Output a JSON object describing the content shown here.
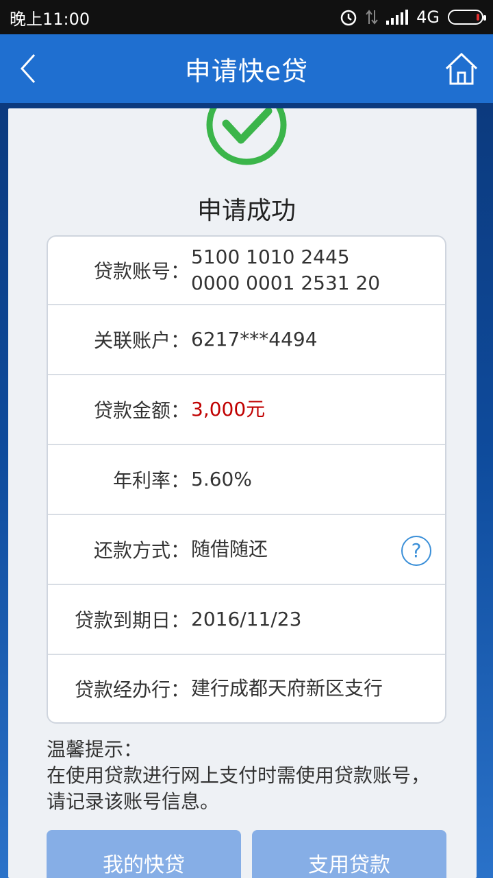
{
  "status_bar": {
    "time": "晚上11:00",
    "network": "4G"
  },
  "nav": {
    "title": "申请快e贷"
  },
  "result": {
    "title": "申请成功"
  },
  "details": [
    {
      "label": "贷款账号：",
      "value": "5100 1010 2445 0000 0001 2531 20"
    },
    {
      "label": "关联账户：",
      "value": "6217***4494"
    },
    {
      "label": "贷款金额：",
      "value": "3,000元"
    },
    {
      "label": "年利率：",
      "value": "5.60%"
    },
    {
      "label": "还款方式：",
      "value": "随借随还"
    },
    {
      "label": "贷款到期日：",
      "value": "2016/11/23"
    },
    {
      "label": "贷款经办行：",
      "value": "建行成都天府新区支行"
    }
  ],
  "help_symbol": "?",
  "tip": {
    "title": "温馨提示：",
    "text": "在使用贷款进行网上支付时需使用贷款账号，请记录该账号信息。"
  },
  "buttons": {
    "my_loan": "我的快贷",
    "use_loan": "支用贷款"
  },
  "colors": {
    "nav": "#1f6fd0",
    "success": "#3bb54a",
    "amount": "#c00000",
    "button": "#86aee6"
  }
}
